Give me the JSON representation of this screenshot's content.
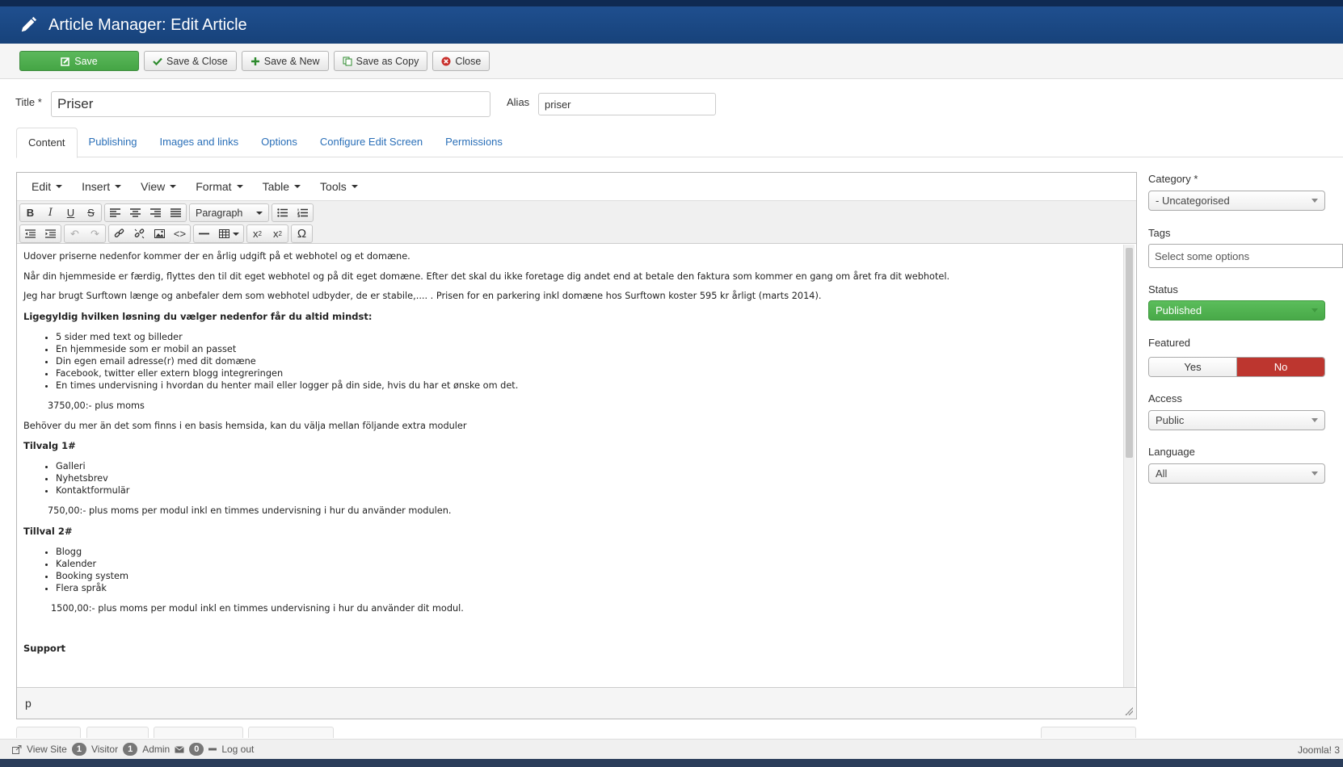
{
  "header": {
    "title": "Article Manager: Edit Article"
  },
  "toolbar": {
    "save": "Save",
    "save_close": "Save & Close",
    "save_new": "Save & New",
    "save_copy": "Save as Copy",
    "close": "Close"
  },
  "form": {
    "title_label": "Title *",
    "title_value": "Priser",
    "alias_label": "Alias",
    "alias_value": "priser"
  },
  "tabs": [
    "Content",
    "Publishing",
    "Images and links",
    "Options",
    "Configure Edit Screen",
    "Permissions"
  ],
  "editor": {
    "menus": [
      "Edit",
      "Insert",
      "View",
      "Format",
      "Table",
      "Tools"
    ],
    "block_format": "Paragraph",
    "path": "p",
    "body": {
      "p1": "Udover priserne nedenfor kommer der en årlig udgift på et webhotel og et domæne.",
      "p2": "Når din hjemmeside er færdig, flyttes den til dit eget webhotel og på dit eget domæne. Efter det skal du ikke foretage dig andet end at betale den faktura som kommer en gang om året fra dit webhotel.",
      "p3": "Jeg har brugt Surftown længe og anbefaler dem som webhotel udbyder, de er stabile,.... . Prisen for en parkering inkl domæne hos Surftown koster 595 kr årligt (marts 2014).",
      "h1": "Ligegyldig hvilken løsning du vælger nedenfor får du altid mindst:",
      "list1": [
        "5 sider med text og billeder",
        "En hjemmeside som er mobil an passet",
        "Din egen email adresse(r) med dit domæne",
        "Facebook, twitter eller extern blogg integreringen",
        "En times undervisning i hvordan du henter mail eller logger på din side, hvis du har et ønske om det."
      ],
      "price1": "3750,00:- plus moms",
      "p4": "Behöver du mer än det som finns i en basis hemsida, kan du välja mellan följande extra moduler",
      "h2": "Tilvalg 1#",
      "list2": [
        "Galleri",
        "Nyhetsbrev",
        "Kontaktformulär"
      ],
      "price2": "750,00:- plus moms per modul inkl en timmes undervisning i hur du använder modulen.",
      "h3": "Tillval 2#",
      "list3": [
        "Blogg",
        "Kalender",
        "Booking system",
        "Flera språk"
      ],
      "price3": "1500,00:- plus moms per modul inkl en timmes undervisning i hur du använder dit modul.",
      "h4": "Support"
    }
  },
  "sidebar": {
    "category_label": "Category *",
    "category_value": "- Uncategorised",
    "tags_label": "Tags",
    "tags_placeholder": "Select some options",
    "status_label": "Status",
    "status_value": "Published",
    "featured_label": "Featured",
    "featured_yes": "Yes",
    "featured_no": "No",
    "access_label": "Access",
    "access_value": "Public",
    "language_label": "Language",
    "language_value": "All"
  },
  "footer": {
    "view_site": "View Site",
    "visitor_count": "1",
    "visitor_label": "Visitor",
    "admin_count": "1",
    "admin_label": "Admin",
    "messages_count": "0",
    "logout": "Log out",
    "brand": "Joomla! 3"
  },
  "colors": {
    "header": "#17427a",
    "save": "#45a545",
    "published": "#48a948",
    "no": "#bd362f",
    "link": "#2a6fb8"
  }
}
